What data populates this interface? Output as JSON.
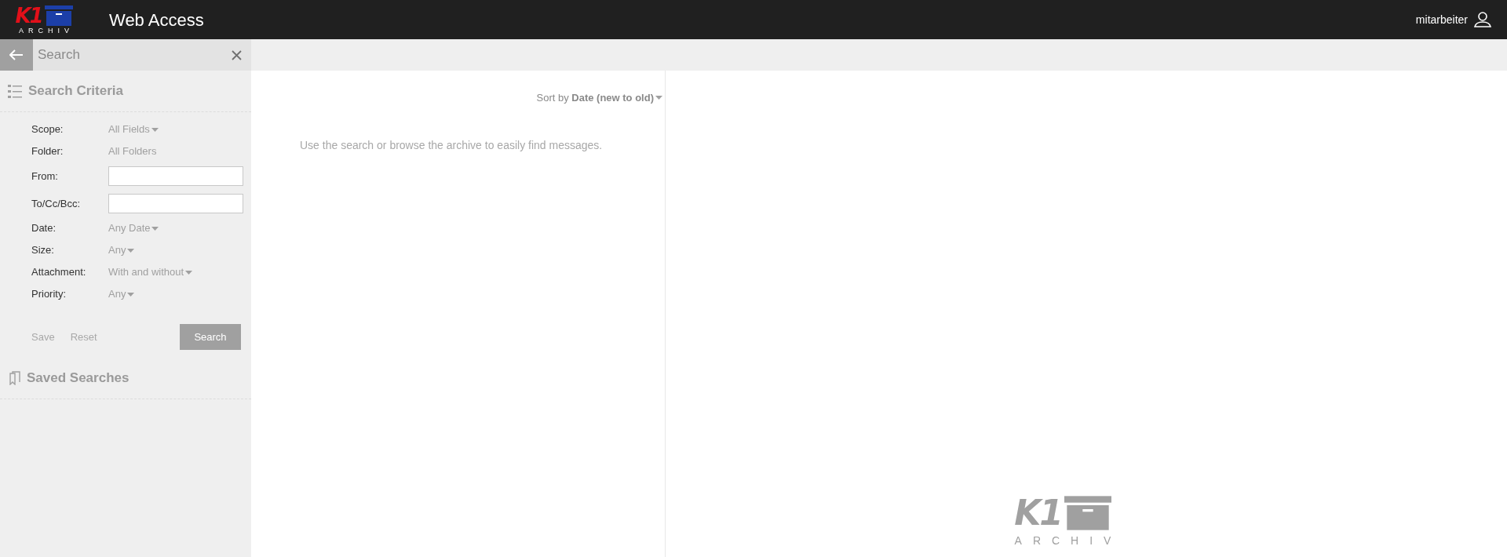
{
  "header": {
    "logo": {
      "mark": "K1",
      "caption": "ARCHIV"
    },
    "title": "Web Access",
    "user": "mitarbeiter"
  },
  "search_bar": {
    "placeholder": "Search"
  },
  "sidebar": {
    "criteria_title": "Search Criteria",
    "criteria": [
      {
        "kind": "dropdown",
        "label": "Scope:",
        "value": "All Fields"
      },
      {
        "kind": "text",
        "label": "Folder:",
        "value": "All Folders"
      },
      {
        "kind": "input",
        "label": "From:"
      },
      {
        "kind": "input",
        "label": "To/Cc/Bcc:"
      },
      {
        "kind": "dropdown",
        "label": "Date:",
        "value": "Any Date"
      },
      {
        "kind": "dropdown",
        "label": "Size:",
        "value": "Any"
      },
      {
        "kind": "dropdown",
        "label": "Attachment:",
        "value": "With and without"
      },
      {
        "kind": "dropdown",
        "label": "Priority:",
        "value": "Any"
      }
    ],
    "links": [
      "Save",
      "Reset"
    ],
    "search_button": "Search",
    "saved_title": "Saved Searches"
  },
  "list": {
    "sort": "Sort by **Date (new to old)**",
    "empty_message": "Use the search or browse the archive to easily find messages."
  },
  "preview": {
    "logo": {
      "mark": "K1",
      "caption": "ARCHIV"
    }
  }
}
